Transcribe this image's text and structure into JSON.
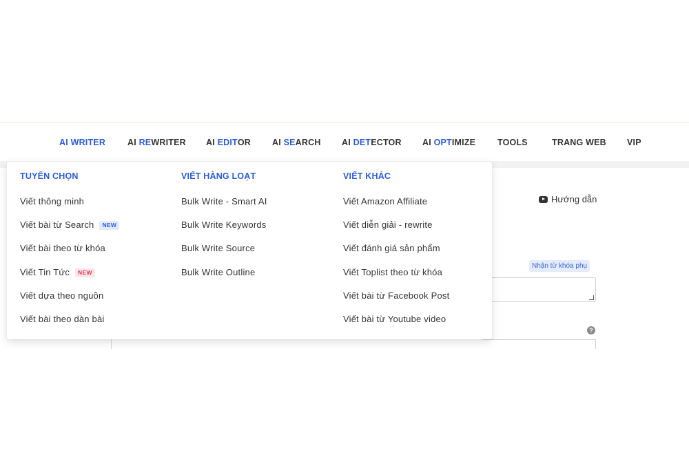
{
  "nav": {
    "items": [
      {
        "pre": "",
        "hl": "AI WRITER",
        "post": "",
        "active": true
      },
      {
        "pre": "AI ",
        "hl": "RE",
        "post": "WRITER"
      },
      {
        "pre": "AI ",
        "hl": "EDIT",
        "post": "OR"
      },
      {
        "pre": "AI ",
        "hl": "SE",
        "post": "ARCH"
      },
      {
        "pre": "AI ",
        "hl": "DET",
        "post": "ECTOR"
      },
      {
        "pre": "AI ",
        "hl": "OPT",
        "post": "IMIZE"
      },
      {
        "pre": "TOOLS",
        "hl": "",
        "post": ""
      },
      {
        "pre": "TRANG WEB",
        "hl": "",
        "post": ""
      },
      {
        "pre": "VIP",
        "hl": "",
        "post": ""
      }
    ],
    "accent": "#2a5bd7"
  },
  "dropdown": {
    "columns": [
      {
        "title": "TUYỂN CHỌN",
        "items": [
          {
            "label": "Viết thông minh"
          },
          {
            "label": "Viết bài từ Search",
            "badge": "NEW",
            "badge_color": "blue"
          },
          {
            "label": "Viết bài theo từ khóa"
          },
          {
            "label": "Viết Tin Tức",
            "badge": "NEW",
            "badge_color": "red"
          },
          {
            "label": "Viết dựa theo nguồn"
          },
          {
            "label": "Viết bài theo dàn bài"
          }
        ]
      },
      {
        "title": "VIẾT HÀNG LOẠT",
        "items": [
          {
            "label": "Bulk Write - Smart AI"
          },
          {
            "label": "Bulk Write Keywords"
          },
          {
            "label": "Bulk Write Source"
          },
          {
            "label": "Bulk Write Outline"
          }
        ]
      },
      {
        "title": "VIẾT KHÁC",
        "items": [
          {
            "label": "Viết Amazon Affiliate"
          },
          {
            "label": "Viết diễn giải - rewrite"
          },
          {
            "label": "Viết đánh giá sản phẩm"
          },
          {
            "label": "Viết Toplist theo từ khóa"
          },
          {
            "label": "Viết bài từ Facebook Post"
          },
          {
            "label": "Viết bài từ Youtube video"
          }
        ]
      }
    ]
  },
  "page": {
    "help_label": "Hướng dẫn",
    "keyword_badge": "Nhận từ khóa phụ",
    "help_icon_glyph": "?"
  }
}
